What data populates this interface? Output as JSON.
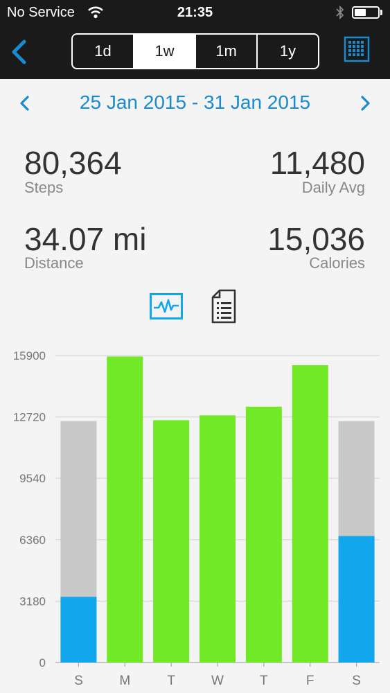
{
  "status_bar": {
    "carrier": "No Service",
    "time": "21:35"
  },
  "nav": {
    "segments": [
      "1d",
      "1w",
      "1m",
      "1y"
    ],
    "active_segment": "1w"
  },
  "date_nav": {
    "range": "25 Jan 2015 - 31 Jan 2015"
  },
  "stats": {
    "steps": {
      "value": "80,364",
      "label": "Steps"
    },
    "daily_avg": {
      "value": "11,480",
      "label": "Daily Avg"
    },
    "distance": {
      "value": "34.07 mi",
      "label": "Distance"
    },
    "calories": {
      "value": "15,036",
      "label": "Calories"
    }
  },
  "view_toggle": {
    "active": "graph"
  },
  "colors": {
    "accent": "#1a8bcf",
    "goal_met": "#72e926",
    "goal_missed": "#12a7ec",
    "goal_bg": "#c8c8c8",
    "bar_text": "#1a1a1a"
  },
  "chart_data": {
    "type": "bar",
    "categories": [
      "S",
      "M",
      "T",
      "W",
      "T",
      "F",
      "S"
    ],
    "ylim": [
      0,
      15900
    ],
    "yticks": [
      0,
      3180,
      6360,
      9540,
      12720,
      15900
    ],
    "goal": 12500,
    "series": [
      {
        "values": [
          3400,
          15850,
          12550,
          12800,
          13250,
          15400,
          6550
        ]
      }
    ],
    "grid": true
  }
}
